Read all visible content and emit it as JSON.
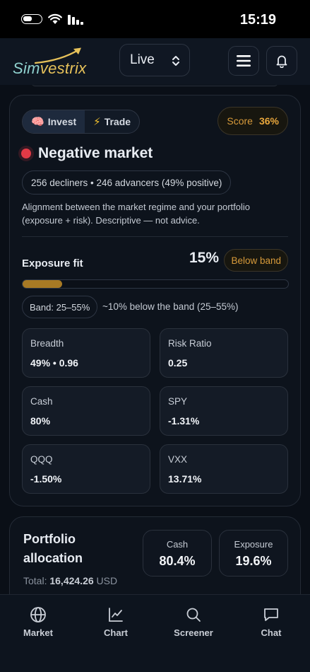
{
  "status_bar": {
    "time": "15:19"
  },
  "header": {
    "logo_part1": "Sim",
    "logo_part2": "vestrix",
    "mode_value": "Live"
  },
  "tabs": {
    "invest": "Invest",
    "trade": "Trade"
  },
  "score": {
    "label": "Score",
    "value": "36%"
  },
  "market": {
    "title": "Negative market",
    "status_color": "#e23a46",
    "breadth_summary": "256 decliners • 246 advancers (49% positive)",
    "description": "Alignment between the market regime and your portfolio (exposure + risk). Descriptive — not advice."
  },
  "exposure": {
    "label": "Exposure fit",
    "percent_text": "15%",
    "fill_fraction": 0.15,
    "band_status": "Below band",
    "band_range": "Band: 25–55%",
    "band_note": "~10% below the band (25–55%)"
  },
  "metrics": [
    {
      "label": "Breadth",
      "value": "49% • 0.96"
    },
    {
      "label": "Risk Ratio",
      "value": "0.25"
    },
    {
      "label": "Cash",
      "value": "80%"
    },
    {
      "label": "SPY",
      "value": "-1.31%"
    },
    {
      "label": "QQQ",
      "value": "-1.50%"
    },
    {
      "label": "VXX",
      "value": "13.71%"
    }
  ],
  "allocation": {
    "title": "Portfolio allocation",
    "total_label": "Total:",
    "total_value": "16,424.26",
    "currency": "USD",
    "cash_label": "Cash",
    "cash_value": "80.4%",
    "exposure_label": "Exposure",
    "exposure_value": "19.6%"
  },
  "nav": {
    "market": "Market",
    "chart": "Chart",
    "screener": "Screener",
    "chat": "Chat"
  },
  "colors": {
    "accent": "#e9a73c",
    "negative": "#e23a46",
    "background": "#0a0f17"
  }
}
